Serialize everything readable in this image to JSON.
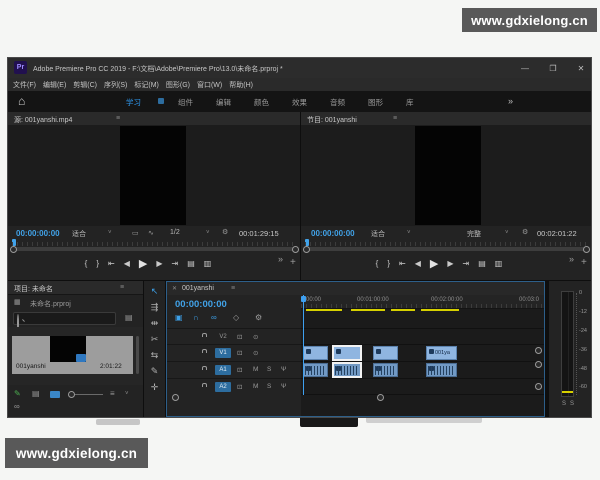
{
  "page": {
    "watermark": "www.gdxielong.cn"
  },
  "titlebar": {
    "app_icon": "Pr",
    "title": "Adobe Premiere Pro CC 2019 - F:\\文档\\Adobe\\Premiere Pro\\13.0\\未命名.prproj *",
    "minimize": "—",
    "maximize": "❐",
    "close": "✕"
  },
  "menubar": {
    "items": [
      "文件(F)",
      "编辑(E)",
      "剪辑(C)",
      "序列(S)",
      "标记(M)",
      "图形(G)",
      "窗口(W)",
      "帮助(H)"
    ]
  },
  "workspace": {
    "home_icon": "⌂",
    "tabs": [
      "学习",
      "组件",
      "编辑",
      "颜色",
      "效果",
      "音频",
      "图形",
      "库"
    ],
    "overflow": "»"
  },
  "icons": {
    "menu": "≡",
    "chevron": "˅",
    "wrench": "⚙",
    "drag_video": "▭",
    "drag_audio": "∿",
    "folder": "▤",
    "grid": "▦",
    "list": "▤",
    "sort": "≡",
    "link_media": "∞",
    "nest": "▣",
    "snap": "∩",
    "linked_selection": "∞",
    "marker": "◇",
    "sync": "⊡",
    "eye": "⊙",
    "mute": "M",
    "solo": "S",
    "mic": "Ψ",
    "more": "»",
    "add": "+",
    "close": "✕",
    "writable": "✎"
  },
  "transport": {
    "mark_in": "{",
    "mark_out": "}",
    "go_in": "⇤",
    "step_back": "◀",
    "play": "▶",
    "step_fwd": "▶",
    "go_out": "⇥",
    "insert": "▤",
    "overwrite": "▥"
  },
  "source": {
    "tab": "源: 001yanshi.mp4",
    "timecode": "00:00:00:00",
    "fit": "适合",
    "zoom_level": "1/2",
    "duration": "00:01:29:15"
  },
  "program": {
    "tab": "节目: 001yanshi",
    "timecode": "00:00:00:00",
    "fit": "适合",
    "quality": "完整",
    "duration": "00:02:01:22"
  },
  "project": {
    "tab": "项目: 未命名",
    "file": "未命名.prproj",
    "search_placeholder": "",
    "item": {
      "name": "001yanshi",
      "duration": "2:01:22"
    }
  },
  "tools": [
    {
      "name": "selection",
      "glyph": "↖"
    },
    {
      "name": "track-select",
      "glyph": "⇶"
    },
    {
      "name": "ripple-edit",
      "glyph": "⇹"
    },
    {
      "name": "razor",
      "glyph": "✂"
    },
    {
      "name": "slip",
      "glyph": "⇆"
    },
    {
      "name": "pen",
      "glyph": "✎"
    },
    {
      "name": "hand",
      "glyph": "✛"
    }
  ],
  "timeline": {
    "tab": "001yanshi",
    "timecode": "00:00:00:00",
    "ruler": [
      "00:00",
      "00:01:00:00",
      "00:02:00:00",
      "00:03:0"
    ],
    "video_tracks": [
      {
        "label": "V2"
      },
      {
        "label": "V1"
      }
    ],
    "audio_tracks": [
      {
        "label": "A1"
      },
      {
        "label": "A2"
      }
    ],
    "clip4_label": "001ya"
  },
  "meter": {
    "scale": [
      "0",
      "-12",
      "-24",
      "-36",
      "-48",
      "-60"
    ],
    "solo_left": "S",
    "solo_right": "S"
  },
  "colors": {
    "accent_blue": "#3da0e8",
    "clip_blue": "#8fb5e0",
    "render_yellow": "#d6d000",
    "track_blue": "#2d6d9f",
    "watermark_bg": "#595959",
    "learn_tab_blue": "#2f9bf5"
  }
}
